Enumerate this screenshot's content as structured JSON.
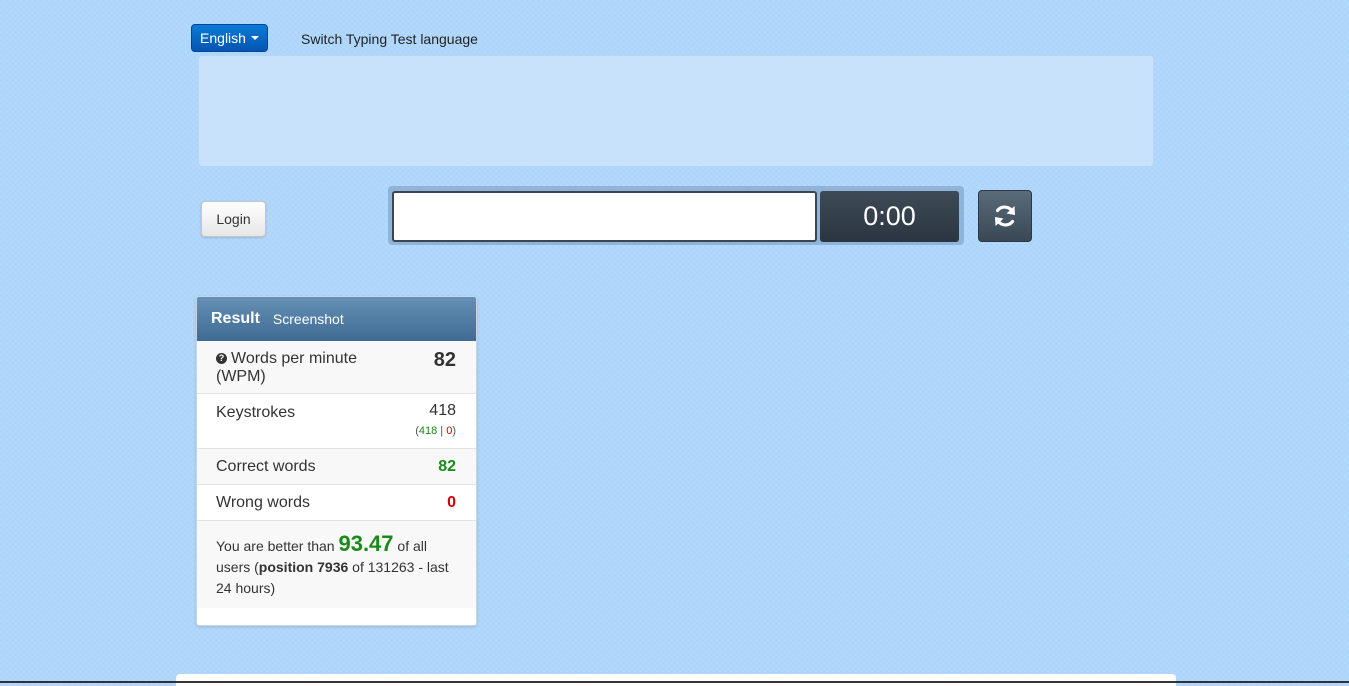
{
  "header": {
    "language_button": "English",
    "switch_label": "Switch Typing Test language"
  },
  "controls": {
    "login_label": "Login",
    "word_input_value": "",
    "timer": "0:00"
  },
  "result": {
    "title": "Result",
    "subtitle": "Screenshot",
    "wpm_label": "Words per minute (WPM)",
    "wpm_value": "82",
    "keystrokes_label": "Keystrokes",
    "keystrokes_value": "418",
    "keystrokes_correct": "418",
    "keystrokes_wrong": "0",
    "correct_words_label": "Correct words",
    "correct_words_value": "82",
    "wrong_words_label": "Wrong words",
    "wrong_words_value": "0",
    "summary_prefix": "You are better than",
    "summary_percent": "93.47",
    "summary_mid": "of all users (",
    "summary_position": "position 7936",
    "summary_suffix": "of 131263 - last 24 hours)"
  },
  "colors": {
    "background": "#abd4fb",
    "accent_blue": "#0a7bd6",
    "panel_header": "#3f6b92",
    "correct": "#1a8a1a",
    "wrong": "#d40000"
  },
  "icons": {
    "language_caret": "caret-down-icon",
    "reload": "refresh-icon",
    "help": "question-circle-icon"
  }
}
